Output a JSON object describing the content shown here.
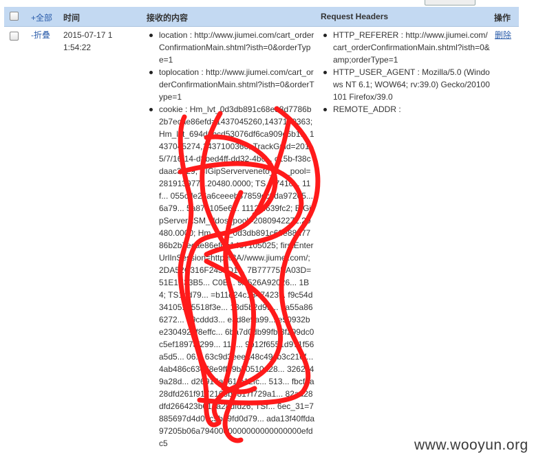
{
  "header": {
    "check_all_label": "",
    "show_all_label": "+全部",
    "col_time": "时间",
    "col_content": "接收的内容",
    "col_headers": "Request Headers",
    "col_action": "操作"
  },
  "row": {
    "collapse_label": "-折叠",
    "time": "2015-07-17 11:54:22",
    "content": [
      "location : http://www.jiumei.com/cart_orderConfirmationMain.shtml?isth=0&orderType=1",
      "toplocation : http://www.jiumei.com/cart_orderConfirmationMain.shtml?isth=0&orderType=1",
      "cookie : Hm_lvt_0d3db891c68e88d7786b2b7ecae86efd=1437045260,1437100363; Hm_lvt_694d6bcd53076df6ca909c6b1... 1437045274,1437100366; TrackGuid=2015/7/16/14-d8bed4ff-dd32-4bc... c15b-f38cdaac3d29; BIGipServerveneto_3..._pool=2819139776.20480.0000; TS... 741c... 11f... 055cde26a6ceeeb57859ccffda97205... 6a79... 5a87b105e6... 11129f639fc2; BIGipServerASM_ddos_pool=2080942272.20480.0000; Hm_lpvt_0d3db891c68e88d7786b2b7ecae86efd=1437105025; firstEnterUrlInSession=http%3A//www.jiumei.com/; 2DA52C316F2453D1... 7B77775EA03D=51E1E33B5... C0B... 9A526A92026... 1B4; TS1bd79... =b11d24c1847423... f9c54d34105... 5518f3e... 13d5b2d99... aa55a866272... 49cddd3... ead8e9a99... e50932be2304921f8effc... 6ba7d0db99fbf3f299dc0c5ef18973f299... 119... 9b12f6551d971f56a5d5... 06... 63c9d3eeea48c49cb3c216f... 4ab486c63478e9ff89b50510a28... 3262c49a28d... d26916a361fb12fc... 513... fbcf4a28dfd261f9172163b5817f729a1... 82aa28dfd266423b619a28dfd26; TSf... 6ec_31=7885697d4d07c5ba9fd0d79... ada13f40ffda97205b06a7940000000000000000000efdc5"
    ],
    "headers": [
      "HTTP_REFERER : http://www.jiumei.com/cart_orderConfirmationMain.shtml?isth=0&amp;orderType=1",
      "HTTP_USER_AGENT : Mozilla/5.0 (Windows NT 6.1; WOW64; rv:39.0) Gecko/20100101 Firefox/39.0",
      "REMOTE_ADDR :"
    ],
    "delete_label": "删除"
  },
  "watermark": "www.wooyun.org",
  "colors": {
    "header_bg": "#c3d9f2",
    "link": "#2a5caa",
    "scribble": "#ff1a1a"
  }
}
